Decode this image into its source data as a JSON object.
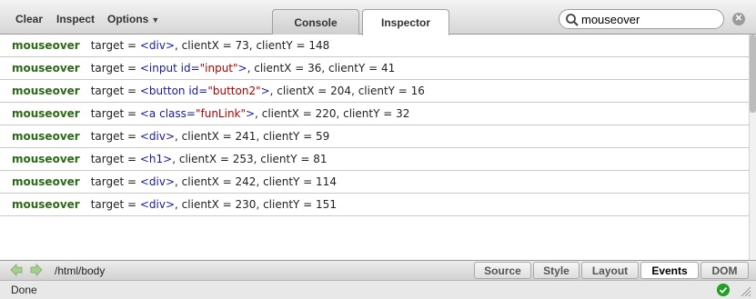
{
  "toolbar": {
    "clear_label": "Clear",
    "inspect_label": "Inspect",
    "options_label": "Options"
  },
  "tabs": {
    "console": "Console",
    "inspector": "Inspector"
  },
  "search": {
    "value": "mouseover"
  },
  "events": [
    {
      "event": "mouseover",
      "pre": "target = ",
      "tag_open": "<div",
      "attr_name": "",
      "attr_value": "",
      "tag_close": ">",
      "post": ", clientX = 73, clientY = 148"
    },
    {
      "event": "mouseover",
      "pre": "target = ",
      "tag_open": "<input",
      "attr_name": " id=",
      "attr_value": "\"input\"",
      "tag_close": ">",
      "post": ", clientX = 36, clientY = 41"
    },
    {
      "event": "mouseover",
      "pre": "target = ",
      "tag_open": "<button",
      "attr_name": " id=",
      "attr_value": "\"button2\"",
      "tag_close": ">",
      "post": ", clientX = 204, clientY = 16"
    },
    {
      "event": "mouseover",
      "pre": "target = ",
      "tag_open": "<a",
      "attr_name": " class=",
      "attr_value": "\"funLink\"",
      "tag_close": ">",
      "post": ", clientX = 220, clientY = 32"
    },
    {
      "event": "mouseover",
      "pre": "target = ",
      "tag_open": "<div",
      "attr_name": "",
      "attr_value": "",
      "tag_close": ">",
      "post": ", clientX = 241, clientY = 59"
    },
    {
      "event": "mouseover",
      "pre": "target = ",
      "tag_open": "<h1",
      "attr_name": "",
      "attr_value": "",
      "tag_close": ">",
      "post": ", clientX = 253, clientY = 81"
    },
    {
      "event": "mouseover",
      "pre": "target = ",
      "tag_open": "<div",
      "attr_name": "",
      "attr_value": "",
      "tag_close": ">",
      "post": ", clientX = 242, clientY = 114"
    },
    {
      "event": "mouseover",
      "pre": "target = ",
      "tag_open": "<div",
      "attr_name": "",
      "attr_value": "",
      "tag_close": ">",
      "post": ", clientX = 230, clientY = 151"
    }
  ],
  "bottom": {
    "path": "/html/body",
    "tabs": [
      "Source",
      "Style",
      "Layout",
      "Events",
      "DOM"
    ],
    "active_tab": "Events"
  },
  "status": {
    "text": "Done"
  },
  "colors": {
    "event_name": "#2b6a16",
    "tag": "#1a1aa6",
    "attr_value": "#b00000",
    "status_ok": "#23a023"
  },
  "icons": [
    "search-icon",
    "clear-search-icon",
    "back-arrow-icon",
    "forward-arrow-icon",
    "status-ok-icon",
    "resize-grip-icon",
    "options-caret-icon"
  ]
}
